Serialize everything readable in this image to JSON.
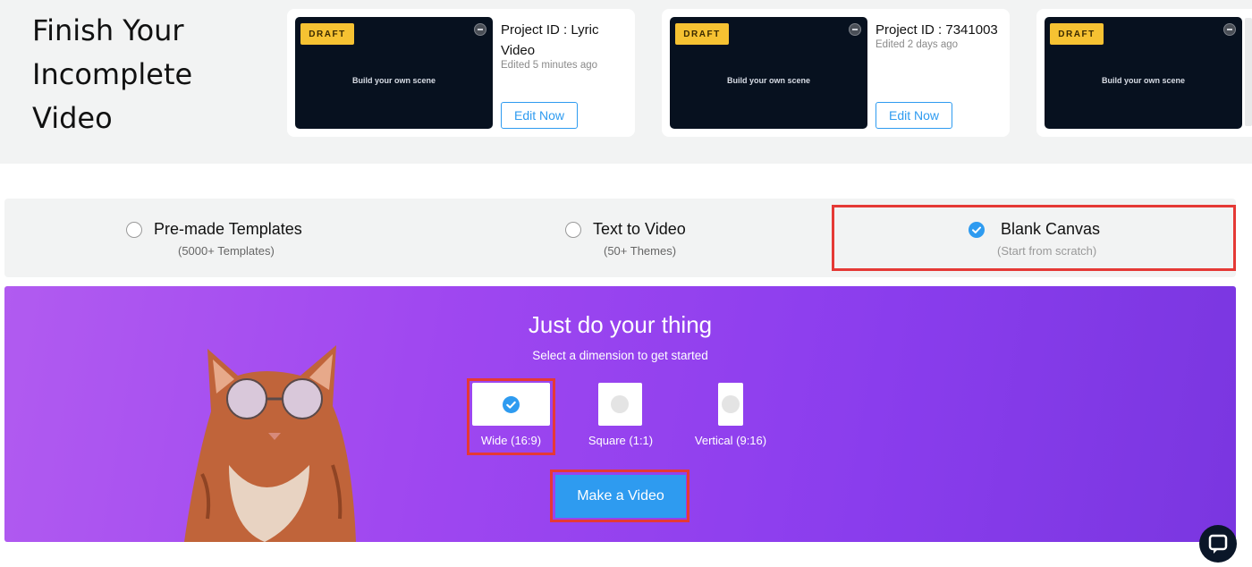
{
  "page_title": "Finish Your Incomplete Video",
  "drafts": [
    {
      "badge": "DRAFT",
      "caption": "Build your own scene",
      "project": "Project ID : Lyric Video",
      "edited": "Edited 5 minutes ago",
      "edit_label": "Edit Now"
    },
    {
      "badge": "DRAFT",
      "caption": "Build your own scene",
      "project": "Project ID : 7341003",
      "edited": "Edited 2 days ago",
      "edit_label": "Edit Now"
    },
    {
      "badge": "DRAFT",
      "caption": "Build your own scene"
    }
  ],
  "modes": [
    {
      "label": "Pre-made Templates",
      "sub": "(5000+ Templates)",
      "selected": false
    },
    {
      "label": "Text to Video",
      "sub": "(50+ Themes)",
      "selected": false
    },
    {
      "label": "Blank Canvas",
      "sub": "(Start from scratch)",
      "selected": true
    }
  ],
  "hero": {
    "title": "Just do your thing",
    "subtitle": "Select a dimension to get started",
    "dimensions": [
      {
        "label": "Wide (16:9)",
        "selected": true
      },
      {
        "label": "Square (1:1)",
        "selected": false
      },
      {
        "label": "Vertical (9:16)",
        "selected": false
      }
    ],
    "cta": "Make a Video"
  },
  "colors": {
    "accent": "#2e9bf0",
    "draft_badge": "#f6c232",
    "hero_gradient_start": "#b15bf0",
    "hero_gradient_end": "#7a36e0",
    "highlight": "#e53935"
  },
  "icons": {
    "check": "check-icon",
    "chat": "chat-icon",
    "avatar": "avatar-icon"
  }
}
